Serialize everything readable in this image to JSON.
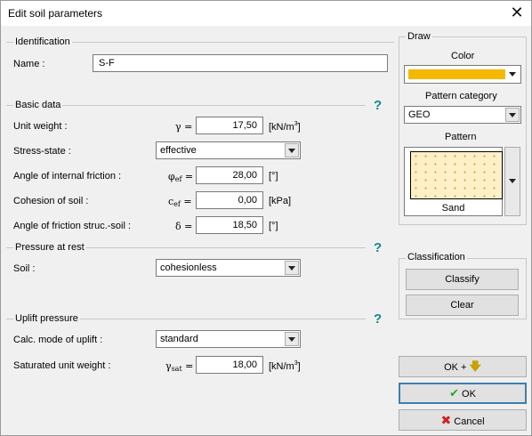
{
  "window": {
    "title": "Edit soil parameters",
    "close_glyph": "✕"
  },
  "identification": {
    "group_title": "Identification",
    "name_label": "Name :",
    "name_value": "S-F"
  },
  "basic_data": {
    "group_title": "Basic data",
    "help": "?",
    "unit_weight": {
      "label": "Unit weight :",
      "symbol": "γ",
      "eq": "=",
      "value": "17,50",
      "unit": "[kN/m",
      "unit_sup": "3",
      "unit_close": "]"
    },
    "stress_state": {
      "label": "Stress-state :",
      "value": "effective"
    },
    "friction_angle": {
      "label": "Angle of internal friction :",
      "symbol": "φ",
      "sub": "ef",
      "eq": "=",
      "value": "28,00",
      "unit": "[°]"
    },
    "cohesion": {
      "label": "Cohesion of soil :",
      "symbol": "c",
      "sub": "ef",
      "eq": "=",
      "value": "0,00",
      "unit": "[kPa]"
    },
    "struc_friction": {
      "label": "Angle of friction struc.-soil :",
      "symbol": "δ",
      "eq": "=",
      "value": "18,50",
      "unit": "[°]"
    }
  },
  "pressure_at_rest": {
    "group_title": "Pressure at rest",
    "help": "?",
    "soil_label": "Soil :",
    "soil_value": "cohesionless"
  },
  "uplift": {
    "group_title": "Uplift pressure",
    "help": "?",
    "mode_label": "Calc. mode of uplift :",
    "mode_value": "standard",
    "sat_label": "Saturated unit weight :",
    "sat_symbol": "γ",
    "sat_sub": "sat",
    "sat_eq": "=",
    "sat_value": "18,00",
    "sat_unit": "[kN/m",
    "sat_unit_sup": "3",
    "sat_unit_close": "]"
  },
  "draw": {
    "group_title": "Draw",
    "color_label": "Color",
    "color_value": "#f5b800",
    "pattern_category_label": "Pattern category",
    "pattern_category_value": "GEO",
    "pattern_label": "Pattern",
    "pattern_name": "Sand"
  },
  "classification": {
    "group_title": "Classification",
    "classify_label": "Classify",
    "clear_label": "Clear"
  },
  "buttons": {
    "ok_plus_label": "OK +",
    "ok_label": "OK",
    "cancel_label": "Cancel"
  },
  "icons": {
    "close": "close-icon",
    "help": "help-icon",
    "ok_plus": "arrow-down-icon",
    "ok": "check-icon",
    "cancel": "x-icon",
    "dropdown": "chevron-down-icon"
  }
}
